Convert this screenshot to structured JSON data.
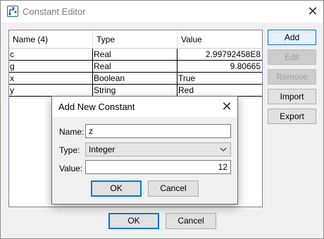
{
  "window": {
    "title": "Constant Editor",
    "close": "✕"
  },
  "table": {
    "columns": [
      "Name (4)",
      "Type",
      "Value"
    ],
    "rows": [
      {
        "name": "c",
        "type": "Real",
        "value": "2.99792458E8"
      },
      {
        "name": "g",
        "type": "Real",
        "value": "9.80665"
      },
      {
        "name": "x",
        "type": "Boolean",
        "value": "True"
      },
      {
        "name": "y",
        "type": "String",
        "value": "Red"
      }
    ]
  },
  "side_buttons": {
    "add": "Add",
    "edit": "Edit",
    "remove": "Remove",
    "import": "Import",
    "export": "Export"
  },
  "footer": {
    "ok": "OK",
    "cancel": "Cancel"
  },
  "dialog": {
    "title": "Add New Constant",
    "close": "✕",
    "name_label": "Name:",
    "name_value": "z",
    "type_label": "Type:",
    "type_value": "Integer",
    "value_label": "Value:",
    "value_value": "12",
    "ok": "OK",
    "cancel": "Cancel"
  },
  "colors": {
    "accent": "#0078d7",
    "dialog_bg": "#f0f0f0",
    "disabled_text": "#a0a0a0"
  },
  "icons": {
    "app": "constant-editor-icon",
    "close": "close-icon",
    "dropdown": "chevron-down-icon"
  }
}
